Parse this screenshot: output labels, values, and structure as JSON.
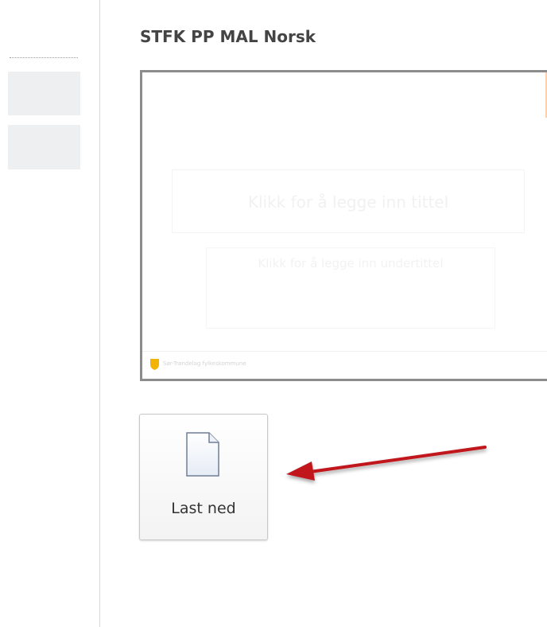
{
  "page": {
    "title": "STFK PP MAL Norsk"
  },
  "preview": {
    "title_placeholder": "Klikk for å legge inn tittel",
    "subtitle_placeholder": "Klikk for å legge inn undertittel",
    "footer_text": "Sør-Trøndelag fylkeskommune",
    "accent_color": "#f4a06a"
  },
  "download": {
    "label": "Last ned",
    "icon": "document-icon"
  },
  "annotation": {
    "arrow_color": "#c0141b"
  }
}
